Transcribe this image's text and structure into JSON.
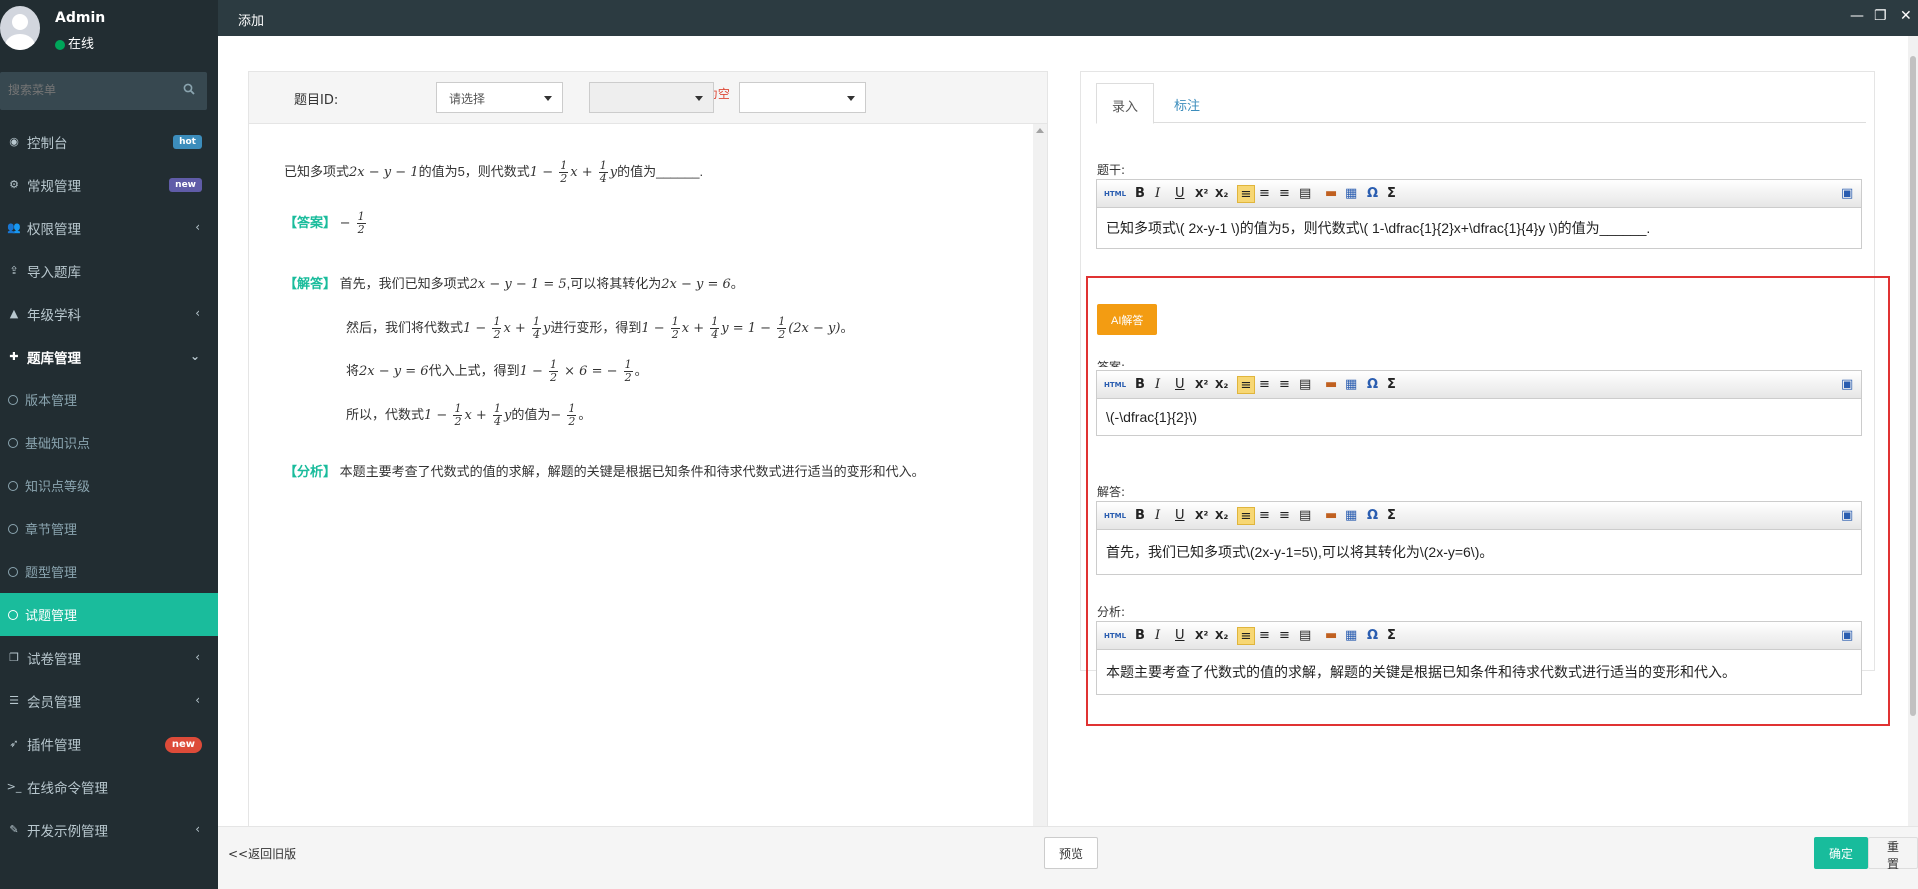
{
  "user": {
    "name": "Admin",
    "status": "在线"
  },
  "search": {
    "placeholder": "搜索菜单"
  },
  "menu": [
    {
      "label": "控制台",
      "icon": "dashboard-icon",
      "badge": "hot"
    },
    {
      "label": "常规管理",
      "icon": "cogs-icon",
      "badge": "new"
    },
    {
      "label": "权限管理",
      "icon": "users-icon",
      "chevron": "left"
    },
    {
      "label": "导入题库",
      "icon": "upload-icon"
    },
    {
      "label": "年级学科",
      "icon": "graduation-icon",
      "chevron": "left"
    },
    {
      "label": "题库管理",
      "icon": "plus-icon",
      "chevron": "down"
    }
  ],
  "submenu": [
    "版本管理",
    "基础知识点",
    "知识点等级",
    "章节管理",
    "题型管理",
    "试题管理"
  ],
  "menu2": [
    {
      "label": "试卷管理",
      "icon": "copy-icon",
      "chevron": "left"
    },
    {
      "label": "会员管理",
      "icon": "list-icon",
      "chevron": "left"
    },
    {
      "label": "插件管理",
      "icon": "rocket-icon",
      "badge": "new"
    },
    {
      "label": "在线命令管理",
      "icon": "terminal-icon"
    },
    {
      "label": "开发示例管理",
      "icon": "magic-icon",
      "chevron": "left"
    }
  ],
  "header": {
    "title": "添加"
  },
  "form": {
    "id_label": "题目ID:",
    "select1": "请选择",
    "error": "此处不能为空",
    "select2": "",
    "select3": ""
  },
  "preview": {
    "stem_a": "已知多项式",
    "stem_b": "的值为5，则代数式",
    "stem_c": "的值为______.",
    "answer_tag": "【答案】",
    "solution_tag": "【解答】",
    "sol1_a": "首先，我们已知多项式",
    "sol1_b": ",可以将其转化为",
    "sol1_c": "。",
    "sol2_a": "然后，我们将代数式",
    "sol2_b": "进行变形，得到",
    "sol2_c": "。",
    "sol3_a": "将",
    "sol3_b": "代入上式，得到",
    "sol3_c": "。",
    "sol4_a": "所以，代数式",
    "sol4_b": "的值为",
    "sol4_c": "。",
    "analysis_tag": "【分析】",
    "analysis": "本题主要考查了代数式的值的求解，解题的关键是根据已知条件和待求代数式进行适当的变形和代入。"
  },
  "tabs": {
    "entry": "录入",
    "annotate": "标注"
  },
  "editors": {
    "stem_label": "题干:",
    "stem": "已知多项式\\( 2x-y-1 \\)的值为5，则代数式\\( 1-\\dfrac{1}{2}x+\\dfrac{1}{4}y \\)的值为______.",
    "ai_button": "AI解答",
    "answer_label": "答案:",
    "answer": "\\(-\\dfrac{1}{2}\\)",
    "solution_label": "解答:",
    "solution": "首先，我们已知多项式\\(2x-y-1=5\\),可以将其转化为\\(2x-y=6\\)。",
    "analysis_label": "分析:",
    "analysis": "本题主要考查了代数式的值的求解，解题的关键是根据已知条件和待求代数式进行适当的变形和代入。"
  },
  "toolbar": {
    "html": "HTML",
    "bold": "B",
    "italic": "I",
    "underline": "U",
    "sup": "X²",
    "sub": "X₂",
    "omega": "Ω",
    "sigma": "Σ"
  },
  "footer": {
    "back": "<<返回旧版",
    "preview": "预览",
    "ok": "确定",
    "reset": "重置"
  },
  "colors": {
    "sidebar": "#222d32",
    "active": "#1abc9c",
    "highlight": "#e03232",
    "ai": "#f39c12"
  }
}
